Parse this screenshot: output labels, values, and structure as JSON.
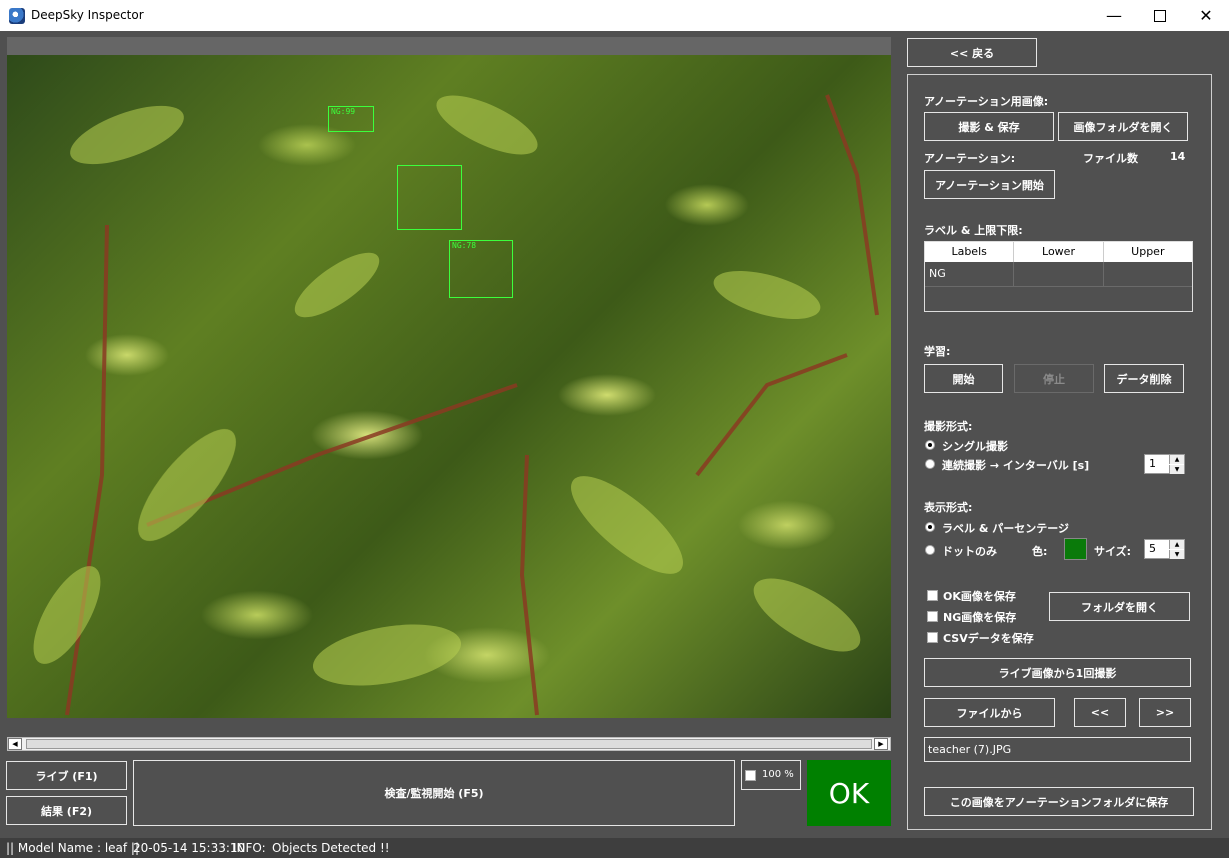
{
  "window": {
    "title": "DeepSky Inspector"
  },
  "detections": [
    {
      "label": "NG:99"
    },
    {
      "label": ""
    },
    {
      "label": "NG:78"
    }
  ],
  "panel": {
    "back": "<< 戻る",
    "annot_image_heading": "アノーテーション用画像:",
    "capture_save": "撮影 & 保存",
    "open_image_folder": "画像フォルダを開く",
    "annotation_heading": "アノーテーション:",
    "file_count_label": "ファイル数",
    "file_count": "14",
    "annotation_start": "アノーテーション開始",
    "label_range_heading": "ラベル & 上限下限:",
    "table": {
      "headers": [
        "Labels",
        "Lower",
        "Upper"
      ],
      "rows": [
        [
          "NG",
          "",
          ""
        ]
      ]
    },
    "learning_heading": "学習:",
    "learn_start": "開始",
    "learn_stop": "停止",
    "data_delete": "データ削除",
    "capture_mode_heading": "撮影形式:",
    "single_capture": "シングル撮影",
    "continuous_capture": "連続撮影 → インターバル [s]",
    "interval_value": "1",
    "display_mode_heading": "表示形式:",
    "label_percentage": "ラベル & パーセンテージ",
    "dot_only": "ドットのみ",
    "color_label": "色:",
    "dot_color": "#0a7a0a",
    "size_label": "サイズ:",
    "size_value": "5",
    "save_ok": "OK画像を保存",
    "save_ng": "NG画像を保存",
    "save_csv": "CSVデータを保存",
    "open_folder": "フォルダを開く",
    "capture_once": "ライブ画像から1回撮影",
    "from_file": "ファイルから",
    "prev": "<<",
    "next": ">>",
    "filename": "teacher (7).JPG",
    "save_to_annotation": "この画像をアノーテーションフォルダに保存"
  },
  "bottom": {
    "live": "ライブ (F1)",
    "result": "結果 (F2)",
    "inspect": "検査/監視開始 (F5)",
    "zoom": "100 %",
    "verdict": "OK",
    "verdict_color": "#008000"
  },
  "status": {
    "model": "|| Model Name : leaf ||",
    "timestamp": "20-05-14 15:33:10",
    "info_label": "INFO:",
    "info": "Objects Detected !!"
  }
}
